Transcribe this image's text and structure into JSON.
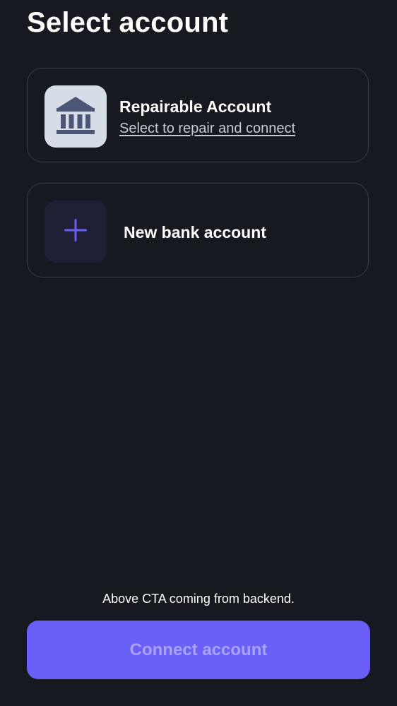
{
  "header": {
    "title": "Select account"
  },
  "accounts": [
    {
      "title": "Repairable Account",
      "subtitle": "Select to repair and connect",
      "icon": "bank-icon"
    },
    {
      "title": "New bank account",
      "icon": "plus-icon"
    }
  ],
  "footer": {
    "note": "Above CTA coming from backend.",
    "cta_label": "Connect account"
  },
  "colors": {
    "background": "#171920",
    "card_border": "#3b3e48",
    "accent": "#6a5ff9",
    "cta_text": "#a9a2fb",
    "bank_tile": "#d7dde7",
    "bank_icon": "#4c5777",
    "plus_tile": "#1f1f35"
  }
}
